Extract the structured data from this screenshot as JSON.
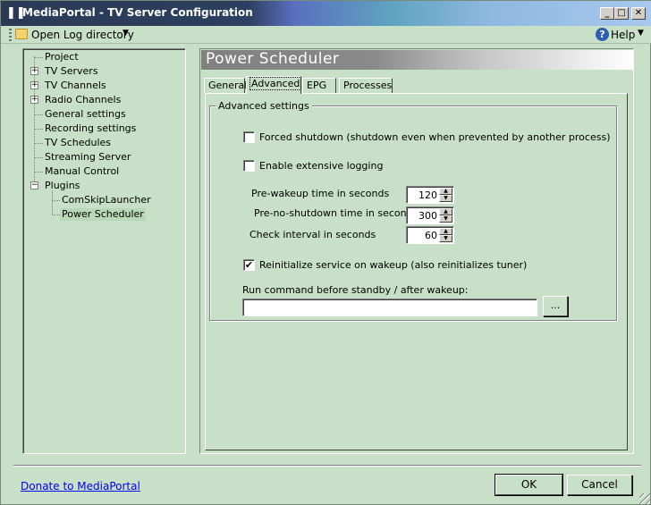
{
  "window": {
    "title": "MediaPortal - TV Server Configuration",
    "icon": "mediaportal-logo-icon"
  },
  "toolbar": {
    "open_log_label": "Open Log directory",
    "help_label": "Help"
  },
  "tree": {
    "items": [
      {
        "label": "Project",
        "expandable": false
      },
      {
        "label": "TV Servers",
        "expandable": true
      },
      {
        "label": "TV Channels",
        "expandable": true
      },
      {
        "label": "Radio Channels",
        "expandable": true
      },
      {
        "label": "General settings",
        "expandable": false
      },
      {
        "label": "Recording settings",
        "expandable": false
      },
      {
        "label": "TV Schedules",
        "expandable": false
      },
      {
        "label": "Streaming Server",
        "expandable": false
      },
      {
        "label": "Manual Control",
        "expandable": false
      },
      {
        "label": "Plugins",
        "expandable": true,
        "expanded": true
      },
      {
        "label": "ComSkipLauncher",
        "expandable": false
      },
      {
        "label": "Power Scheduler",
        "expandable": false,
        "selected": true
      }
    ]
  },
  "panel": {
    "title": "Power Scheduler",
    "tabs": [
      {
        "label": "General"
      },
      {
        "label": "Advanced",
        "active": true
      },
      {
        "label": "EPG"
      },
      {
        "label": "Processes"
      }
    ]
  },
  "advanced": {
    "group_title": "Advanced settings",
    "forced_shutdown": {
      "label": "Forced shutdown (shutdown even when prevented by another process)",
      "checked": false
    },
    "extensive_logging": {
      "label": "Enable extensive logging",
      "checked": false
    },
    "pre_wakeup": {
      "label": "Pre-wakeup time in seconds",
      "value": "120"
    },
    "pre_no_shutdown": {
      "label": "Pre-no-shutdown time in seconds",
      "value": "300"
    },
    "check_interval": {
      "label": "Check interval in seconds",
      "value": "60"
    },
    "reinitialize": {
      "label": "Reinitialize service on wakeup (also reinitializes tuner)",
      "checked": true,
      "mark": "✔"
    },
    "run_command": {
      "label": "Run command before standby / after wakeup:",
      "value": ""
    },
    "browse_label": "..."
  },
  "footer": {
    "donate_label": "Donate to MediaPortal",
    "ok_label": "OK",
    "cancel_label": "Cancel"
  },
  "colors": {
    "background": "#c8dfc8",
    "title_bar_dark": "#2a3a55",
    "link": "#0000ee"
  }
}
